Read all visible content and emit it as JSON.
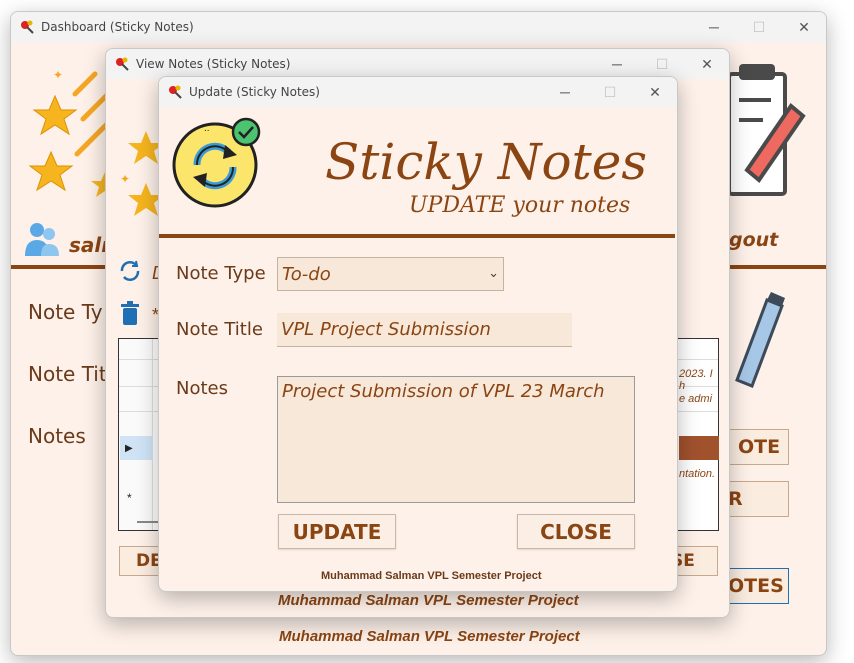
{
  "colors": {
    "brown": "#8b4513",
    "window_bg": "#fdf1e9",
    "titlebar_bg": "#f3f3f3"
  },
  "dashboard": {
    "title": "Dashboard (Sticky Notes)",
    "user": "salm",
    "logout": "gout",
    "labels": {
      "note_type": "Note Ty",
      "note_title": "Note Tit",
      "notes": "Notes"
    },
    "buttons": {
      "add_note": "OTE",
      "clear": "R",
      "view_notes": "OTES"
    },
    "footer": "Muhammad Salman VPL Semester Project",
    "icons": [
      "stars-icon",
      "user-icon",
      "clipboard-pencil-icon",
      "pen-icon"
    ]
  },
  "view_notes": {
    "title": "View Notes (Sticky Notes)",
    "refresh_label": "D",
    "delete_label": "*",
    "row_snippets": [
      "2023. I h",
      "e admi",
      "ntation."
    ],
    "buttons": {
      "delete": "DE",
      "close": "SE"
    },
    "footer": "Muhammad Salman VPL Semester Project"
  },
  "update": {
    "title": "Update (Sticky Notes)",
    "app_title": "Sticky Notes",
    "subtitle": "UPDATE your notes",
    "labels": {
      "note_type": "Note Type",
      "note_title": "Note Title",
      "notes": "Notes"
    },
    "note_type_value": "To-do",
    "note_title_value": "VPL Project Submission",
    "notes_value": "Project Submission of VPL 23 March",
    "buttons": {
      "update": "UPDATE",
      "close": "CLOSE"
    },
    "footer": "Muhammad Salman VPL Semester Project"
  }
}
